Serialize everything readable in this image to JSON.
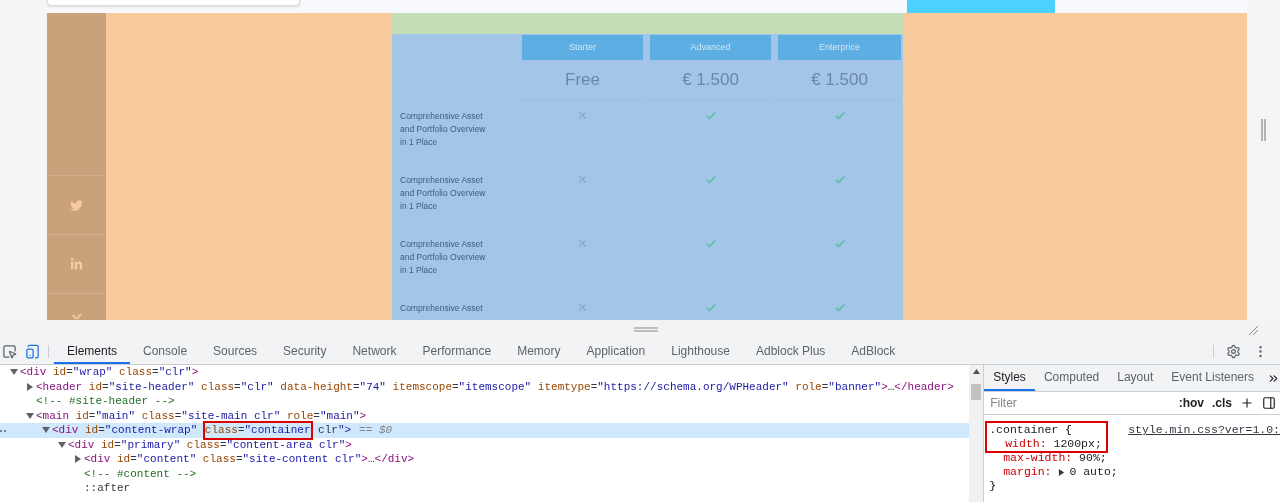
{
  "pricing_table": {
    "plans": [
      {
        "name": "Starter",
        "price": "Free"
      },
      {
        "name": "Advanced",
        "price": "€ 1.500"
      },
      {
        "name": "Enterprice",
        "price": "€ 1.500"
      }
    ],
    "features": [
      {
        "label": "Comprehensive Asset\nand Portfolio Overview\nin 1 Place",
        "included": [
          false,
          true,
          true
        ]
      },
      {
        "label": "Comprehensive Asset\nand Portfolio Overview\nin 1 Place",
        "included": [
          false,
          true,
          true
        ]
      },
      {
        "label": "Comprehensive Asset\nand Portfolio Overview\nin 1 Place",
        "included": [
          false,
          true,
          true
        ]
      },
      {
        "label": "Comprehensive Asset",
        "included": [
          false,
          true,
          true
        ]
      }
    ]
  },
  "devtools": {
    "tabs": [
      {
        "label": "Elements",
        "selected": true
      },
      {
        "label": "Console",
        "selected": false
      },
      {
        "label": "Sources",
        "selected": false
      },
      {
        "label": "Security",
        "selected": false
      },
      {
        "label": "Network",
        "selected": false
      },
      {
        "label": "Performance",
        "selected": false
      },
      {
        "label": "Memory",
        "selected": false
      },
      {
        "label": "Application",
        "selected": false
      },
      {
        "label": "Lighthouse",
        "selected": false
      },
      {
        "label": "Adblock Plus",
        "selected": false
      },
      {
        "label": "AdBlock",
        "selected": false
      }
    ],
    "dom_tree": [
      {
        "kind": "element",
        "expanded": true,
        "selected": false,
        "segments": [
          {
            "text": "<div id=\"wrap\" class=\"clr\">",
            "boxed": false
          }
        ],
        "children": [
          {
            "kind": "element",
            "expanded": false,
            "selected": false,
            "segments": [
              {
                "text": "<header id=\"site-header\" class=\"clr\" data-height=\"74\" itemscope=\"itemscope\" itemtype=\"https://schema.org/WPHeader\" role=\"banner\">…</header>",
                "boxed": false
              }
            ]
          },
          {
            "kind": "comment",
            "selected": false,
            "segments": [
              {
                "text": "<!-- #site-header -->",
                "boxed": false
              }
            ]
          },
          {
            "kind": "element",
            "expanded": true,
            "selected": false,
            "segments": [
              {
                "text": "<main id=\"main\" class=\"site-main clr\" role=\"main\">",
                "boxed": false
              }
            ],
            "children": [
              {
                "kind": "element",
                "expanded": true,
                "selected": true,
                "suffix": "== $0",
                "segments": [
                  {
                    "text": "<div id=\"content-wrap\" ",
                    "boxed": false
                  },
                  {
                    "text": "class=\"container",
                    "boxed": true
                  },
                  {
                    "text": " clr\">",
                    "boxed": false
                  }
                ],
                "children": [
                  {
                    "kind": "element",
                    "expanded": true,
                    "selected": false,
                    "segments": [
                      {
                        "text": "<div id=\"primary\" class=\"content-area clr\">",
                        "boxed": false
                      }
                    ],
                    "children": [
                      {
                        "kind": "element",
                        "expanded": false,
                        "selected": false,
                        "segments": [
                          {
                            "text": "<div id=\"content\" class=\"site-content clr\">…</div>",
                            "boxed": false
                          }
                        ]
                      },
                      {
                        "kind": "comment",
                        "selected": false,
                        "segments": [
                          {
                            "text": "<!-- #content -->",
                            "boxed": false
                          }
                        ]
                      },
                      {
                        "kind": "pseudo",
                        "selected": false,
                        "segments": [
                          {
                            "text": "::after",
                            "boxed": false
                          }
                        ]
                      }
                    ]
                  }
                ]
              }
            ]
          }
        ]
      }
    ],
    "styles_panel": {
      "tabs": [
        {
          "label": "Styles",
          "selected": true
        },
        {
          "label": "Computed",
          "selected": false
        },
        {
          "label": "Layout",
          "selected": false
        },
        {
          "label": "Event Listeners",
          "selected": false
        }
      ],
      "filter": {
        "placeholder": "Filter"
      },
      "buttons": [
        ":hov",
        ".cls"
      ],
      "rule": {
        "selector": ".container",
        "open": "{",
        "close": "}",
        "source": "style.min.css?ver=1.0:",
        "declarations": [
          {
            "property": "width:",
            "value": "1200px;",
            "boxed": true,
            "expandable": false
          },
          {
            "property": "max-width:",
            "value": "90%;",
            "boxed": false,
            "expandable": false
          },
          {
            "property": "margin:",
            "value": "0 auto;",
            "boxed": false,
            "expandable": true
          }
        ]
      }
    }
  }
}
